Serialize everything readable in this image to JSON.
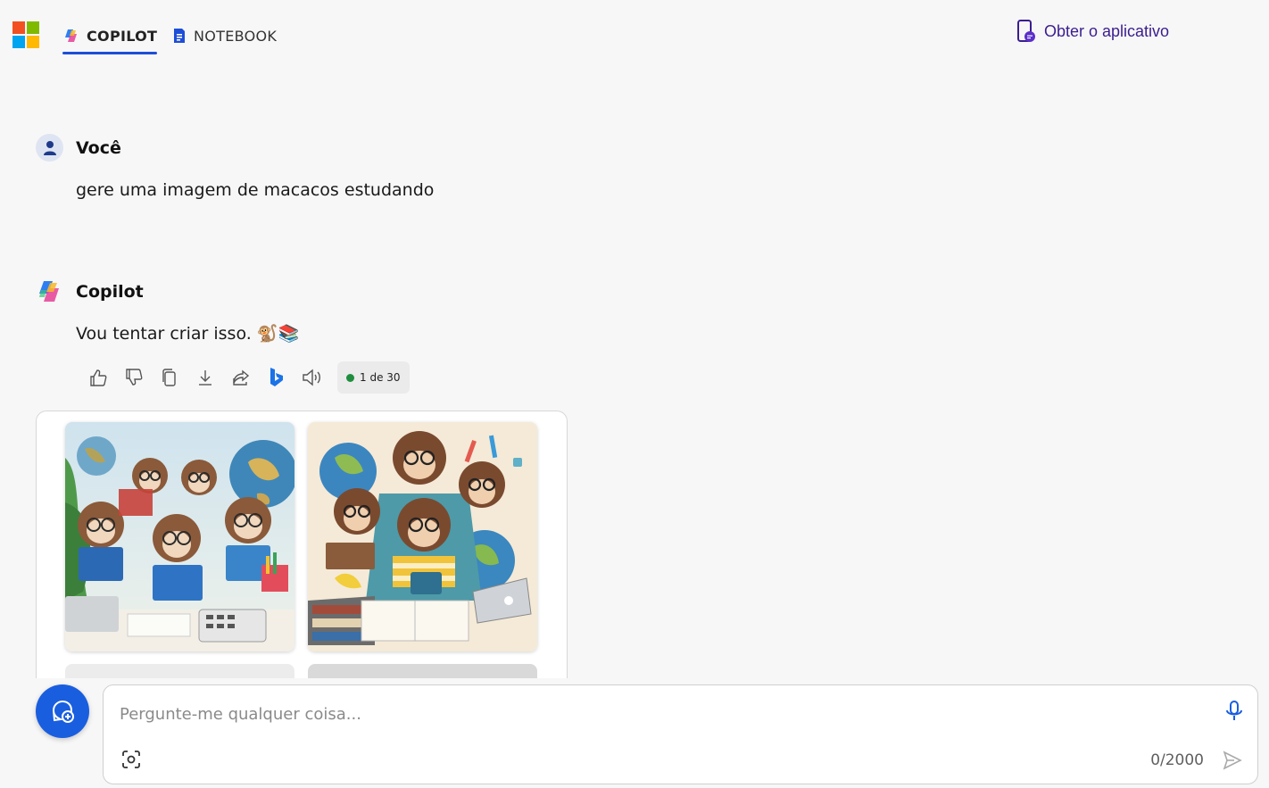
{
  "header": {
    "tabs": [
      {
        "label": "COPILOT",
        "active": true
      },
      {
        "label": "NOTEBOOK",
        "active": false
      }
    ],
    "get_app_label": "Obter o aplicativo"
  },
  "conversation": {
    "user": {
      "name": "Você",
      "message": "gere uma imagem de macacos estudando"
    },
    "assistant": {
      "name": "Copilot",
      "message": "Vou tentar criar isso. 🐒📚",
      "actions": [
        "thumbs-up-icon",
        "thumbs-down-icon",
        "copy-icon",
        "download-icon",
        "share-icon",
        "bing-icon",
        "read-aloud-icon"
      ],
      "response_counter": "1 de 30",
      "images": [
        {
          "subject": "monkeys with glasses reading blue books beside a globe"
        },
        {
          "subject": "monkeys with glasses studying with globes, calculator and laptop"
        }
      ]
    }
  },
  "composer": {
    "placeholder": "Pergunte-me qualquer coisa...",
    "value": "",
    "char_count": "0/2000"
  },
  "colors": {
    "accent": "#1d4ed8",
    "new_chat_button": "#1a5ee0",
    "get_app_text": "#3b1d8f",
    "status_dot": "#1e8e3e"
  }
}
